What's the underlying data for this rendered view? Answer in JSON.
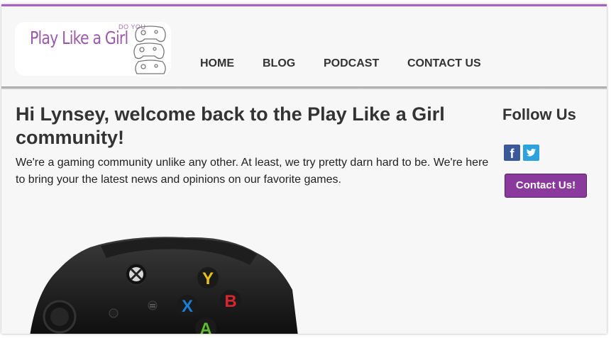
{
  "logo": {
    "prefix": "DO YOU",
    "text": "Play Like a Girl"
  },
  "nav": {
    "items": [
      "HOME",
      "BLOG",
      "PODCAST",
      "CONTACT US"
    ]
  },
  "main": {
    "welcome": "Hi Lynsey, welcome back to the Play Like a Girl community!",
    "intro": "We're a gaming community unlike any other. At least, we try pretty darn hard to be. We're here to bring your the latest news and opinions on our favorite games."
  },
  "sidebar": {
    "follow_title": "Follow Us",
    "contact_button": "Contact Us!",
    "social_icons": [
      "facebook-icon",
      "twitter-icon"
    ]
  },
  "controller": {
    "buttons": [
      "Y",
      "B",
      "X",
      "A"
    ]
  },
  "colors": {
    "accent": "#a960c0",
    "button": "#8a3a9c",
    "facebook": "#3b5998",
    "twitter": "#2da2dd",
    "y_button": "#e8c21a",
    "b_button": "#d7262c",
    "x_button": "#1a7fd6",
    "a_button": "#5fbf2a"
  }
}
